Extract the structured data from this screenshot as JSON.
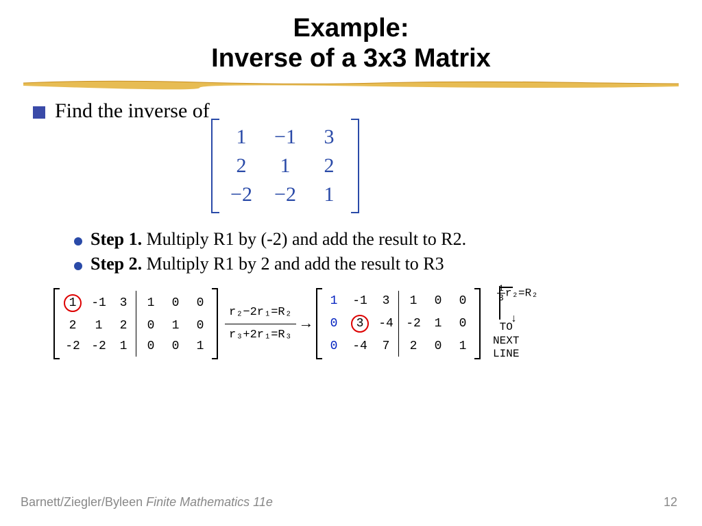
{
  "title": {
    "line1": "Example:",
    "line2": "Inverse of a 3x3 Matrix"
  },
  "prompt": "Find the inverse of",
  "matrix": {
    "r1": [
      "1",
      "−1",
      "3"
    ],
    "r2": [
      "2",
      "1",
      "2"
    ],
    "r3": [
      "−2",
      "−2",
      "1"
    ]
  },
  "steps": [
    {
      "label": "Step 1.",
      "text": " Multiply R1 by (-2) and add the result to R2."
    },
    {
      "label": "Step 2.",
      "text": " Multiply R1 by 2 and add the result to R3"
    }
  ],
  "aug1": {
    "left": [
      [
        "1",
        "-1",
        "3"
      ],
      [
        "2",
        "1",
        "2"
      ],
      [
        "-2",
        "-2",
        "1"
      ]
    ],
    "right": [
      [
        "1",
        "0",
        "0"
      ],
      [
        "0",
        "1",
        "0"
      ],
      [
        "0",
        "0",
        "1"
      ]
    ],
    "circled": [
      0,
      0
    ]
  },
  "ops1": {
    "l1": "r₂−2r₁=R₂",
    "l2": "r₃+2r₁=R₃"
  },
  "aug2": {
    "left": [
      [
        "1",
        "-1",
        "3"
      ],
      [
        "0",
        "3",
        "-4"
      ],
      [
        "0",
        "-4",
        "7"
      ]
    ],
    "right": [
      [
        "1",
        "0",
        "0"
      ],
      [
        "-2",
        "1",
        "0"
      ],
      [
        "2",
        "0",
        "1"
      ]
    ],
    "circled": [
      1,
      1
    ]
  },
  "ops2": {
    "frac_n": "1",
    "frac_d": "3",
    "rest": "r₂=R₂"
  },
  "endnote": [
    "TO",
    "NEXT",
    "LINE"
  ],
  "footer": {
    "authors": "Barnett/Ziegler/Byleen ",
    "book": "Finite Mathematics 11e",
    "page": "12"
  }
}
